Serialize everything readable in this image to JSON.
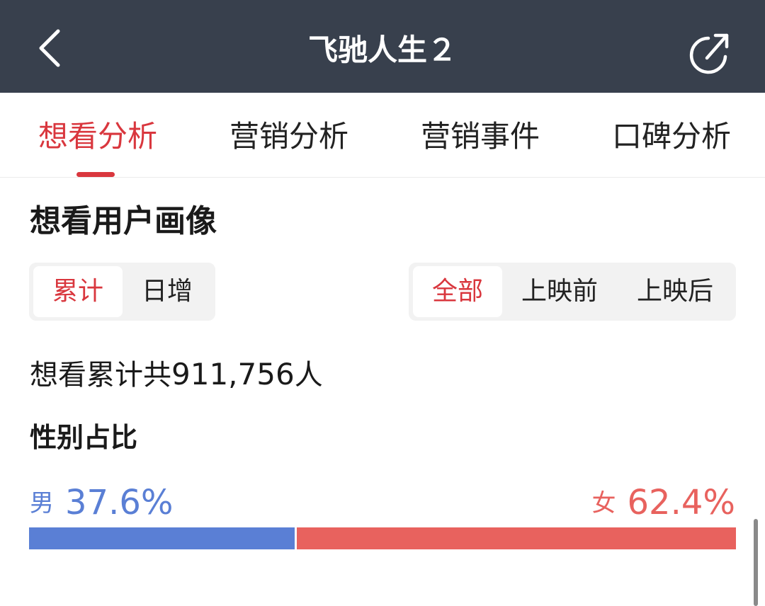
{
  "header": {
    "title": "飞驰人生２",
    "back_icon": "chevron-left-icon",
    "share_icon": "share-icon"
  },
  "tabs": [
    {
      "label": "想看分析",
      "active": true
    },
    {
      "label": "营销分析",
      "active": false
    },
    {
      "label": "营销事件",
      "active": false
    },
    {
      "label": "口碑分析",
      "active": false
    }
  ],
  "section": {
    "title": "想看用户画像"
  },
  "period_toggle": {
    "options": [
      "累计",
      "日增"
    ],
    "selected": "累计"
  },
  "phase_toggle": {
    "options": [
      "全部",
      "上映前",
      "上映后"
    ],
    "selected": "全部"
  },
  "summary": {
    "prefix": "想看累计共",
    "count": "911,756",
    "suffix": "人"
  },
  "gender": {
    "title": "性别占比",
    "male": {
      "label": "男",
      "percent_text": "37.6%",
      "percent": 37.6
    },
    "female": {
      "label": "女",
      "percent_text": "62.4%",
      "percent": 62.4
    }
  },
  "colors": {
    "accent": "#d9373e",
    "header_bg": "#38404d",
    "male": "#5a7fd5",
    "female": "#e8625e"
  }
}
